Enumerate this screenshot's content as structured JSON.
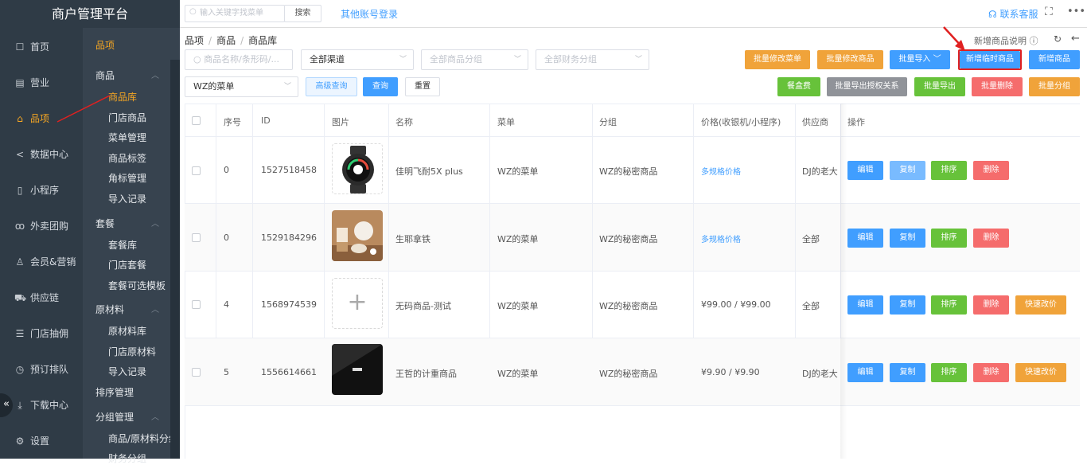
{
  "app": {
    "title": "商户管理平台"
  },
  "primary_nav": [
    {
      "label": "首页",
      "icon": "home-icon"
    },
    {
      "label": "营业",
      "icon": "calendar-icon"
    },
    {
      "label": "品项",
      "icon": "bag-icon",
      "active": true
    },
    {
      "label": "数据中心",
      "icon": "share-icon"
    },
    {
      "label": "小程序",
      "icon": "phone-icon"
    },
    {
      "label": "外卖团购",
      "icon": "bike-icon"
    },
    {
      "label": "会员&营销",
      "icon": "user-icon"
    },
    {
      "label": "供应链",
      "icon": "truck-icon"
    },
    {
      "label": "门店抽佣",
      "icon": "database-icon"
    },
    {
      "label": "预订排队",
      "icon": "clock-icon"
    },
    {
      "label": "下载中心",
      "icon": "download-icon"
    },
    {
      "label": "设置",
      "icon": "gear-icon"
    }
  ],
  "secondary_nav": {
    "title": "品项",
    "groups": [
      {
        "label": "商品",
        "items": [
          "商品库",
          "门店商品",
          "菜单管理",
          "商品标签",
          "角标管理",
          "导入记录"
        ]
      },
      {
        "label": "套餐",
        "items": [
          "套餐库",
          "门店套餐",
          "套餐可选模板"
        ]
      },
      {
        "label": "原材料",
        "items": [
          "原材料库",
          "门店原材料",
          "导入记录"
        ]
      },
      {
        "label": "排序管理",
        "items": []
      },
      {
        "label": "分组管理",
        "items": [
          "商品/原材料分组",
          "财务分组"
        ]
      }
    ],
    "active_item": "商品库"
  },
  "topbar": {
    "menu_search_placeholder": "输入关键字找菜单",
    "search_button": "搜索",
    "other_login": "其他账号登录",
    "contact": "联系客服",
    "fullscreen_icon": "fullscreen-icon",
    "more_icon": "more-icon"
  },
  "breadcrumb": [
    "品项",
    "商品",
    "商品库"
  ],
  "help_link": "新增商品说明",
  "filters": {
    "keyword_placeholder": "商品名称/条形码/...",
    "channel": "全部渠道",
    "category_placeholder": "全部商品分组",
    "finance_placeholder": "全部财务分组",
    "menu": "WZ的菜单",
    "advanced": "高级查询",
    "query": "查询",
    "reset": "重置"
  },
  "actions_row1": [
    "批量修改菜单",
    "批量修改商品",
    "批量导入",
    "新增临时商品",
    "新增商品"
  ],
  "actions_row2": [
    "餐盒费",
    "批量导出授权关系",
    "批量导出",
    "批量删除",
    "批量分组"
  ],
  "table": {
    "headers": [
      "序号",
      "ID",
      "图片",
      "名称",
      "菜单",
      "分组",
      "价格(收银机/小程序)",
      "供应商",
      "操作"
    ],
    "rows": [
      {
        "seq": "0",
        "id": "1527518458",
        "image": "watch",
        "name": "佳明飞耐5X plus",
        "menu": "WZ的菜单",
        "group": "WZ的秘密商品",
        "price": "多规格价格",
        "price_link": true,
        "supplier": "DJ的老大",
        "ops": [
          "编辑",
          "复制",
          "排序",
          "删除"
        ]
      },
      {
        "seq": "0",
        "id": "1529184296",
        "image": "latte",
        "name": "生耶拿铁",
        "menu": "WZ的菜单",
        "group": "WZ的秘密商品",
        "price": "多规格价格",
        "price_link": true,
        "supplier": "全部",
        "ops": [
          "编辑",
          "复制",
          "排序",
          "删除"
        ]
      },
      {
        "seq": "4",
        "id": "1568974539",
        "image": "placeholder",
        "name": "无码商品-测试",
        "menu": "WZ的菜单",
        "group": "WZ的秘密商品",
        "price": "¥99.00 / ¥99.00",
        "price_link": false,
        "supplier": "全部",
        "ops": [
          "编辑",
          "复制",
          "排序",
          "删除",
          "快速改价"
        ]
      },
      {
        "seq": "5",
        "id": "1556614661",
        "image": "device",
        "name": "王哲的计重商品",
        "menu": "WZ的菜单",
        "group": "WZ的秘密商品",
        "price": "¥9.90 / ¥9.90",
        "price_link": false,
        "supplier": "DJ的老大",
        "ops": [
          "编辑",
          "复制",
          "排序",
          "删除",
          "快速改价"
        ]
      }
    ]
  },
  "colors": {
    "sidebar": "#2f3b46",
    "sidebar2": "#37434f",
    "accent": "#f5a623",
    "primary": "#409eff",
    "success": "#67c23a",
    "danger": "#f56c6c",
    "warning": "#f0a33a",
    "highlight": "#e02020"
  }
}
